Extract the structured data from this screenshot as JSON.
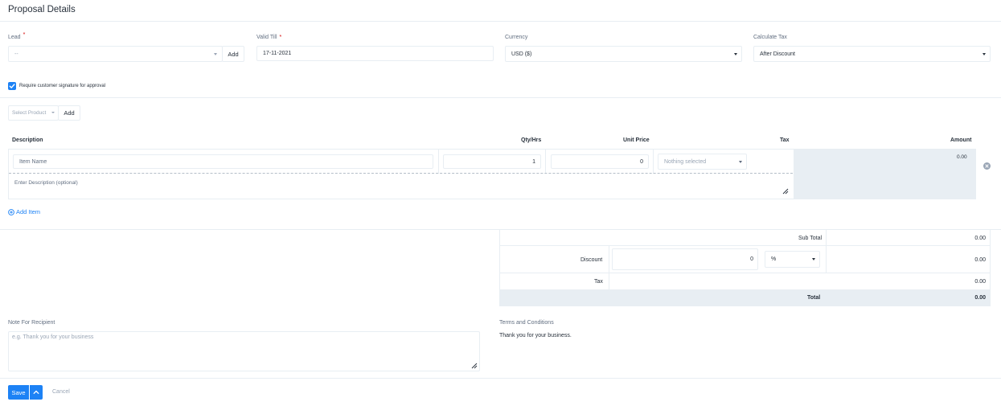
{
  "header": {
    "title": "Proposal Details"
  },
  "lead": {
    "label": "Lead",
    "required_mark": "*",
    "value": "--",
    "add_label": "Add"
  },
  "valid_till": {
    "label": "Valid Till",
    "required_mark": "*",
    "value": "17-11-2021"
  },
  "currency": {
    "label": "Currency",
    "value": "USD ($)"
  },
  "calculate_tax": {
    "label": "Calculate Tax",
    "value": "After Discount"
  },
  "signature": {
    "label": "Require customer signature for approval",
    "checked": true
  },
  "product": {
    "placeholder": "Select Product",
    "add_label": "Add"
  },
  "items_table": {
    "headers": {
      "description": "Description",
      "qty": "Qty/Hrs",
      "unit_price": "Unit Price",
      "tax": "Tax",
      "amount": "Amount"
    },
    "row": {
      "item_name_placeholder": "Item Name",
      "qty": "1",
      "unit_price": "0",
      "tax_placeholder": "Nothing selected",
      "amount": "0.00",
      "description_placeholder": "Enter Description (optional)"
    },
    "add_item_label": "Add Item"
  },
  "totals": {
    "sub_total_label": "Sub Total",
    "sub_total_value": "0.00",
    "discount_label": "Discount",
    "discount_value": "0",
    "discount_type": "%",
    "discount_amount": "0.00",
    "tax_label": "Tax",
    "tax_value": "0.00",
    "total_label": "Total",
    "total_value": "0.00"
  },
  "note": {
    "label": "Note For Recipient",
    "placeholder": "e.g. Thank you for your business"
  },
  "terms": {
    "label": "Terms and Conditions",
    "text": "Thank you for your business."
  },
  "footer": {
    "save_label": "Save",
    "cancel_label": "Cancel"
  },
  "colors": {
    "primary": "#1d82f5",
    "border": "#e8eef3",
    "muted": "#616e80",
    "grey_fill": "#e8eef3"
  }
}
